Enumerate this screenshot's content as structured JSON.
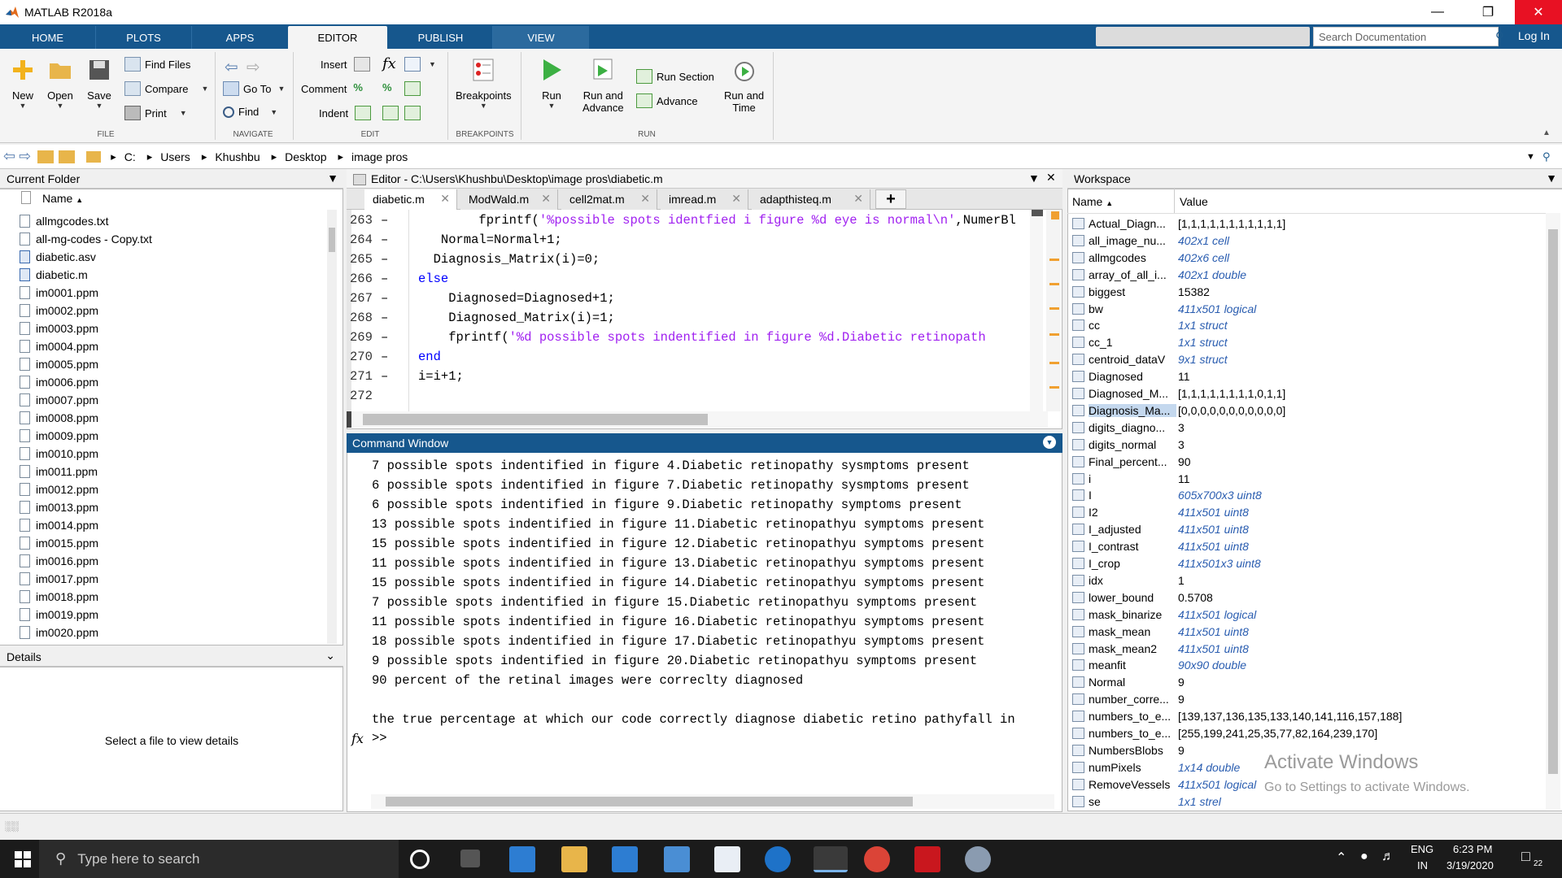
{
  "window": {
    "title": "MATLAB R2018a"
  },
  "ribbon_tabs": [
    "HOME",
    "PLOTS",
    "APPS",
    "EDITOR",
    "PUBLISH",
    "VIEW"
  ],
  "active_tab": "EDITOR",
  "search_documentation": {
    "placeholder": "Search Documentation"
  },
  "login": "Log In",
  "ribbon": {
    "file": {
      "new": "New",
      "open": "Open",
      "save": "Save",
      "find_files": "Find Files",
      "compare": "Compare",
      "print": "Print",
      "group": "FILE"
    },
    "navigate": {
      "go_to": "Go To",
      "find": "Find",
      "group": "NAVIGATE"
    },
    "edit": {
      "insert": "Insert",
      "comment": "Comment",
      "indent": "Indent",
      "fx": "fx",
      "group": "EDIT"
    },
    "breakpoints": {
      "label": "Breakpoints",
      "group": "BREAKPOINTS"
    },
    "run": {
      "run": "Run",
      "run_and_advance_1": "Run and",
      "run_and_advance_2": "Advance",
      "run_section": "Run Section",
      "advance": "Advance",
      "run_and_time_1": "Run and",
      "run_and_time_2": "Time",
      "group": "RUN"
    }
  },
  "address": [
    "C:",
    "Users",
    "Khushbu",
    "Desktop",
    "image pros"
  ],
  "current_folder": {
    "title": "Current Folder",
    "column": "Name",
    "files": [
      "allmgcodes.txt",
      "all-mg-codes - Copy.txt",
      "diabetic.asv",
      "diabetic.m",
      "im0001.ppm",
      "im0002.ppm",
      "im0003.ppm",
      "im0004.ppm",
      "im0005.ppm",
      "im0006.ppm",
      "im0007.ppm",
      "im0008.ppm",
      "im0009.ppm",
      "im0010.ppm",
      "im0011.ppm",
      "im0012.ppm",
      "im0013.ppm",
      "im0014.ppm",
      "im0015.ppm",
      "im0016.ppm",
      "im0017.ppm",
      "im0018.ppm",
      "im0019.ppm",
      "im0020.ppm"
    ]
  },
  "details": {
    "title": "Details",
    "message": "Select a file to view details"
  },
  "editor": {
    "title": "Editor - C:\\Users\\Khushbu\\Desktop\\image pros\\diabetic.m",
    "tabs": [
      "diabetic.m",
      "ModWald.m",
      "cell2mat.m",
      "imread.m",
      "adapthisteq.m"
    ],
    "lines": [
      {
        "n": "263",
        "dash": "–",
        "code": [
          {
            "t": "        fprintf(",
            "c": ""
          },
          {
            "t": "'%possible spots identfied i figure %d eye is normal\\n'",
            "c": "str"
          },
          {
            "t": ",NumerBl",
            "c": ""
          }
        ]
      },
      {
        "n": "264",
        "dash": "–",
        "code": [
          {
            "t": "   Normal=Normal+1;",
            "c": ""
          }
        ]
      },
      {
        "n": "265",
        "dash": "–",
        "code": [
          {
            "t": "  Diagnosis_Matrix(i)=0;",
            "c": ""
          }
        ]
      },
      {
        "n": "266",
        "dash": "–",
        "code": [
          {
            "t": "else",
            "c": "kw"
          }
        ]
      },
      {
        "n": "267",
        "dash": "–",
        "code": [
          {
            "t": "    Diagnosed=Diagnosed+1;",
            "c": ""
          }
        ]
      },
      {
        "n": "268",
        "dash": "–",
        "code": [
          {
            "t": "    Diagnosed_Matrix(i)=1;",
            "c": ""
          }
        ]
      },
      {
        "n": "269",
        "dash": "–",
        "code": [
          {
            "t": "    fprintf(",
            "c": ""
          },
          {
            "t": "'%d possible spots indentified in figure %d.Diabetic retinopath",
            "c": "str"
          }
        ]
      },
      {
        "n": "270",
        "dash": "–",
        "code": [
          {
            "t": "end",
            "c": "kw"
          }
        ]
      },
      {
        "n": "271",
        "dash": "–",
        "code": [
          {
            "t": "i=i+1;",
            "c": ""
          }
        ]
      },
      {
        "n": "272",
        "dash": "",
        "code": []
      }
    ]
  },
  "command_window": {
    "title": "Command Window",
    "lines": [
      "7 possible spots indentified in figure 4.Diabetic retinopathy sysmptoms present",
      "6 possible spots indentified in figure 7.Diabetic retinopathy sysmptoms present",
      "6 possible spots indentified in figure 9.Diabetic retinopathy symptoms present",
      "13 possible spots indentified in figure 11.Diabetic retinopathyu symptoms present",
      "15 possible spots indentified in figure 12.Diabetic retinopathyu symptoms present",
      "11 possible spots indentified in figure 13.Diabetic retinopathyu symptoms present",
      "15 possible spots indentified in figure 14.Diabetic retinopathyu symptoms present",
      "7 possible spots indentified in figure 15.Diabetic retinopathyu symptoms present",
      "11 possible spots indentified in figure 16.Diabetic retinopathyu symptoms present",
      "18 possible spots indentified in figure 17.Diabetic retinopathyu symptoms present",
      "9 possible spots indentified in figure 20.Diabetic retinopathyu symptoms present",
      "90 percent of the retinal images were correclty diagnosed",
      "",
      "the true percentage at which our code correctly diagnose diabetic retino pathyfall in"
    ],
    "prompt": ">>",
    "fx": "fx"
  },
  "workspace": {
    "title": "Workspace",
    "col_name": "Name",
    "col_value": "Value",
    "rows": [
      {
        "name": "Actual_Diagn...",
        "value": "[1,1,1,1,1,1,1,1,1,1,1]",
        "italic": false
      },
      {
        "name": "all_image_nu...",
        "value": "402x1 cell",
        "italic": true
      },
      {
        "name": "allmgcodes",
        "value": "402x6 cell",
        "italic": true
      },
      {
        "name": "array_of_all_i...",
        "value": "402x1 double",
        "italic": true
      },
      {
        "name": "biggest",
        "value": "15382",
        "italic": false
      },
      {
        "name": "bw",
        "value": "411x501 logical",
        "italic": true
      },
      {
        "name": "cc",
        "value": "1x1 struct",
        "italic": true
      },
      {
        "name": "cc_1",
        "value": "1x1 struct",
        "italic": true
      },
      {
        "name": "centroid_dataV",
        "value": "9x1 struct",
        "italic": true
      },
      {
        "name": "Diagnosed",
        "value": "11",
        "italic": false
      },
      {
        "name": "Diagnosed_M...",
        "value": "[1,1,1,1,1,1,1,1,0,1,1]",
        "italic": false
      },
      {
        "name": "Diagnosis_Ma...",
        "value": "[0,0,0,0,0,0,0,0,0,0,0]",
        "italic": false,
        "selected": true
      },
      {
        "name": "digits_diagno...",
        "value": "3",
        "italic": false
      },
      {
        "name": "digits_normal",
        "value": "3",
        "italic": false
      },
      {
        "name": "Final_percent...",
        "value": "90",
        "italic": false
      },
      {
        "name": "i",
        "value": "11",
        "italic": false
      },
      {
        "name": "I",
        "value": "605x700x3 uint8",
        "italic": true
      },
      {
        "name": "I2",
        "value": "411x501 uint8",
        "italic": true
      },
      {
        "name": "I_adjusted",
        "value": "411x501 uint8",
        "italic": true
      },
      {
        "name": "I_contrast",
        "value": "411x501 uint8",
        "italic": true
      },
      {
        "name": "I_crop",
        "value": "411x501x3 uint8",
        "italic": true
      },
      {
        "name": "idx",
        "value": "1",
        "italic": false
      },
      {
        "name": "lower_bound",
        "value": "0.5708",
        "italic": false
      },
      {
        "name": "mask_binarize",
        "value": "411x501 logical",
        "italic": true
      },
      {
        "name": "mask_mean",
        "value": "411x501 uint8",
        "italic": true
      },
      {
        "name": "mask_mean2",
        "value": "411x501 uint8",
        "italic": true
      },
      {
        "name": "meanfit",
        "value": "90x90 double",
        "italic": true
      },
      {
        "name": "Normal",
        "value": "9",
        "italic": false
      },
      {
        "name": "number_corre...",
        "value": "9",
        "italic": false
      },
      {
        "name": "numbers_to_e...",
        "value": "[139,137,136,135,133,140,141,116,157,188]",
        "italic": false
      },
      {
        "name": "numbers_to_e...",
        "value": "[255,199,241,25,35,77,82,164,239,170]",
        "italic": false
      },
      {
        "name": "NumbersBlobs",
        "value": "9",
        "italic": false
      },
      {
        "name": "numPixels",
        "value": "1x14 double",
        "italic": true
      },
      {
        "name": "RemoveVessels",
        "value": "411x501 logical",
        "italic": true
      },
      {
        "name": "se",
        "value": "1x1 strel",
        "italic": true
      }
    ]
  },
  "watermark": {
    "line1": "Activate Windows",
    "line2": "Go to Settings to activate Windows."
  },
  "taskbar": {
    "search": "Type here to search",
    "lang1": "ENG",
    "lang2": "IN",
    "time": "6:23 PM",
    "date": "3/19/2020",
    "notifications": "22"
  },
  "colors": {
    "ribbon_blue": "#16578d",
    "keyword": "#0000ff",
    "string": "#a020f0",
    "italic_value": "#2a5db0"
  }
}
